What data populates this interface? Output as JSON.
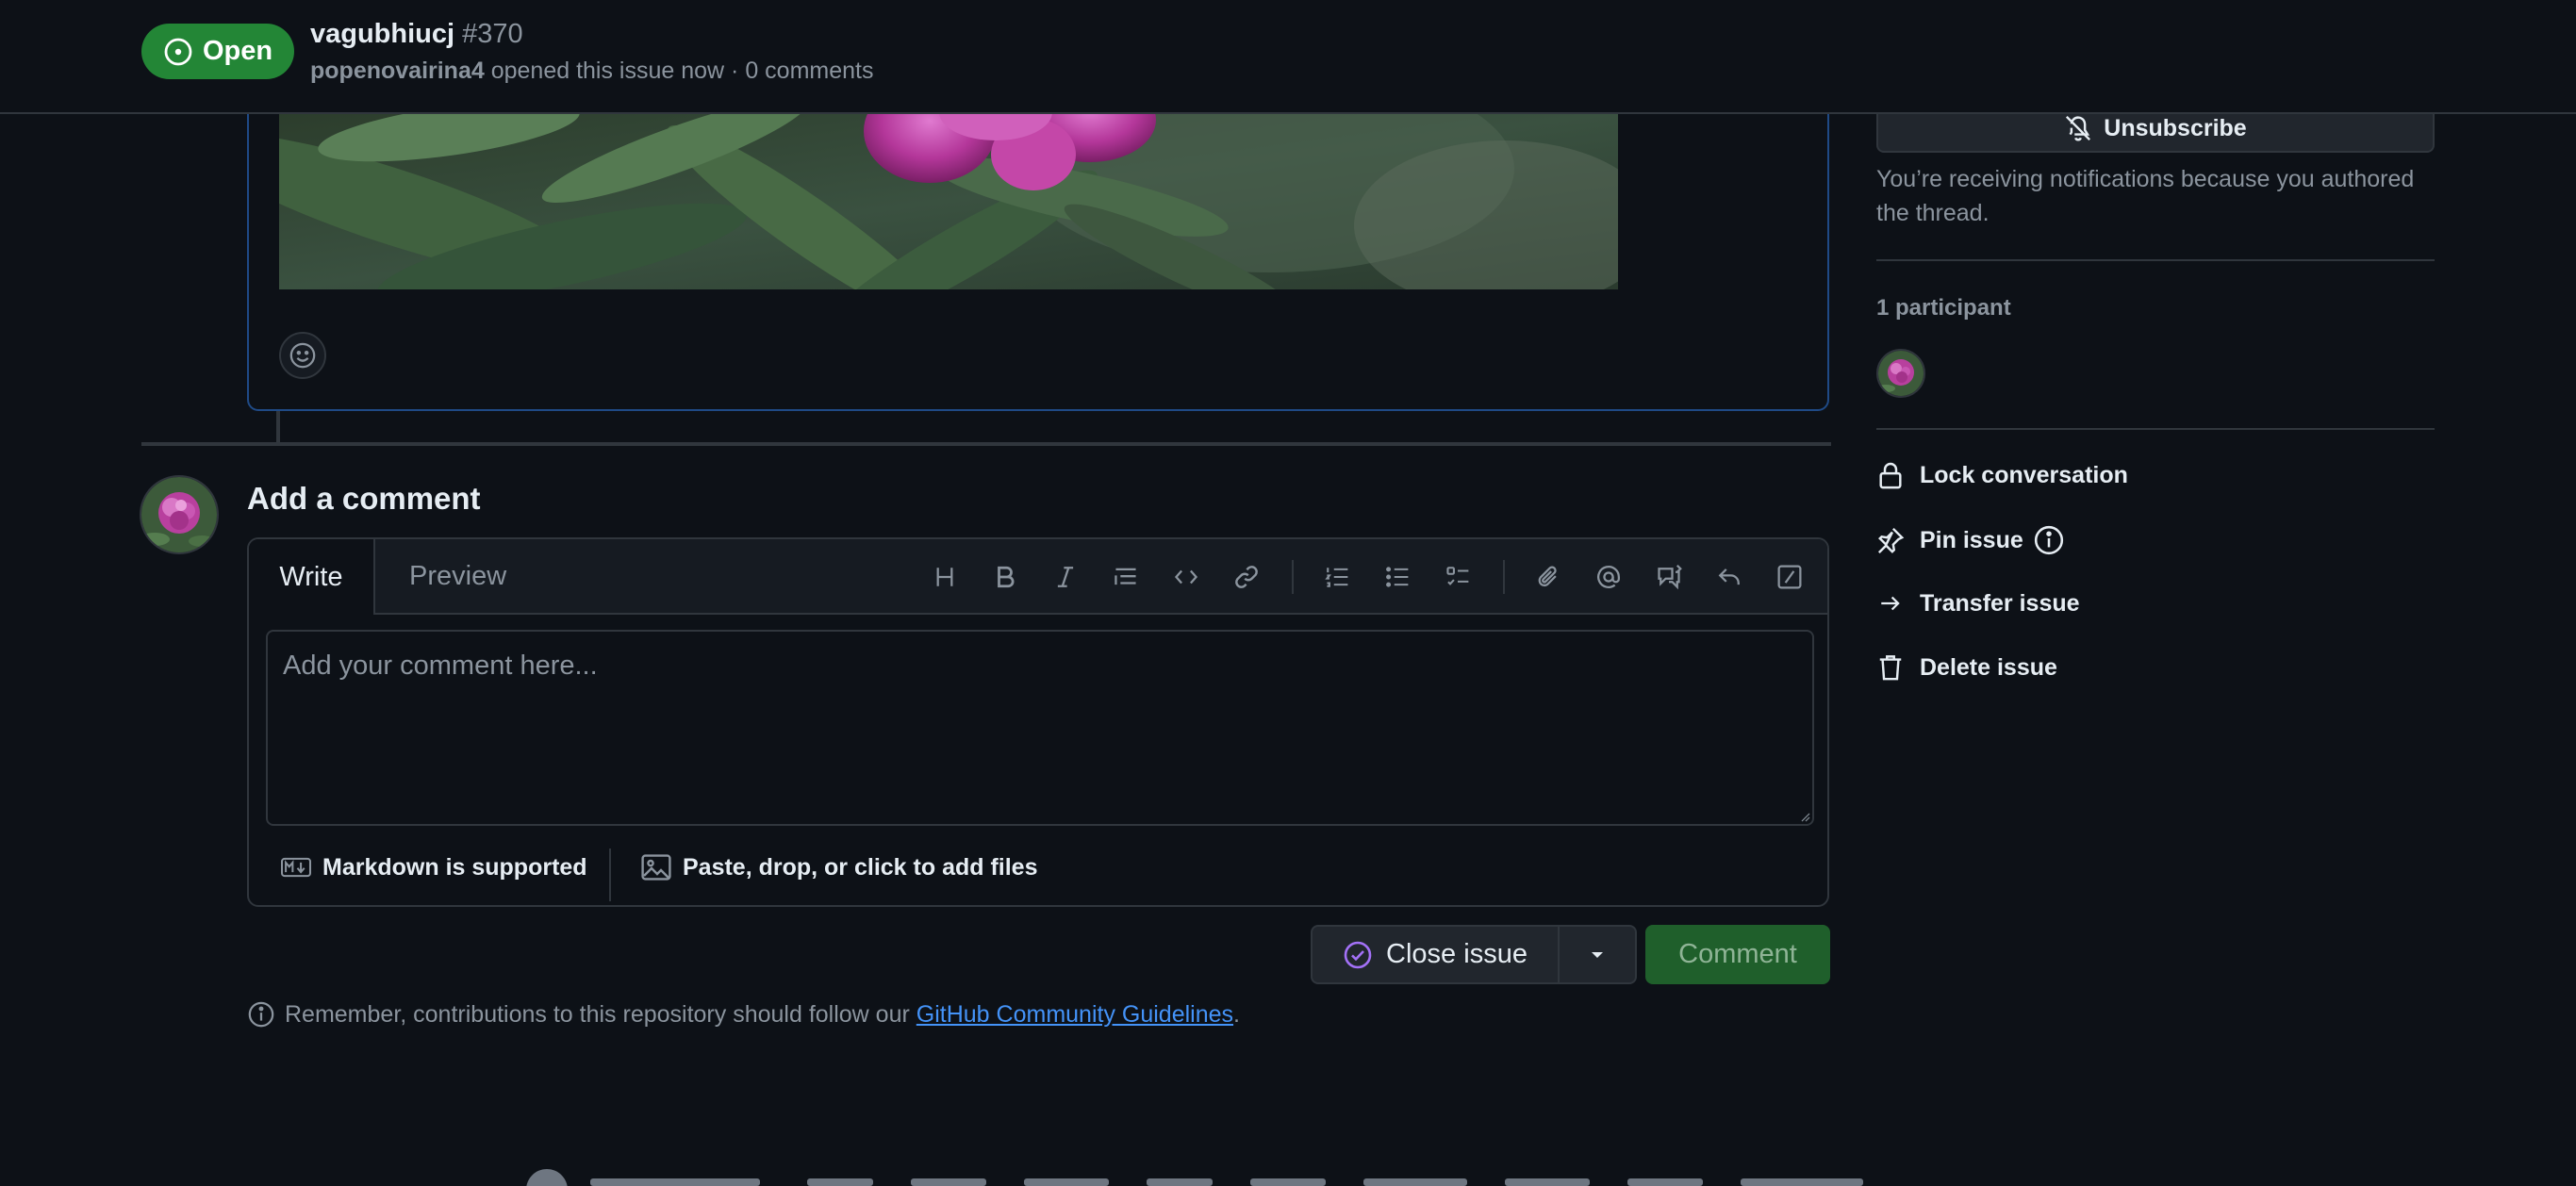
{
  "header": {
    "state_label": "Open",
    "issue_title": "vagubhiucj",
    "issue_number": "#370",
    "author": "popenovairina4",
    "meta_text": "opened this issue now · 0 comments"
  },
  "composer": {
    "title": "Add a comment",
    "tab_write": "Write",
    "tab_preview": "Preview",
    "placeholder": "Add your comment here...",
    "markdown_label": "Markdown is supported",
    "files_label": "Paste, drop, or click to add files",
    "toolbar_icons": [
      "heading-icon",
      "bold-icon",
      "italic-icon",
      "quote-icon",
      "code-icon",
      "link-icon",
      "ordered-list-icon",
      "unordered-list-icon",
      "task-list-icon",
      "attach-icon",
      "mention-icon",
      "cross-reference-icon",
      "reply-icon",
      "slash-command-icon"
    ]
  },
  "actions": {
    "close_issue": "Close issue",
    "comment": "Comment"
  },
  "guidelines": {
    "prefix": "Remember, contributions to this repository should follow our",
    "link": "GitHub Community Guidelines",
    "suffix": "."
  },
  "sidebar": {
    "unsubscribe": "Unsubscribe",
    "notification_text": "You’re receiving notifications because you authored the thread.",
    "participants": "1 participant",
    "lock": "Lock conversation",
    "pin": "Pin issue",
    "transfer": "Transfer issue",
    "delete": "Delete issue"
  },
  "colors": {
    "background": "#0d1117",
    "open_green": "#238636",
    "link_blue": "#4493f8",
    "border": "#30363d"
  }
}
